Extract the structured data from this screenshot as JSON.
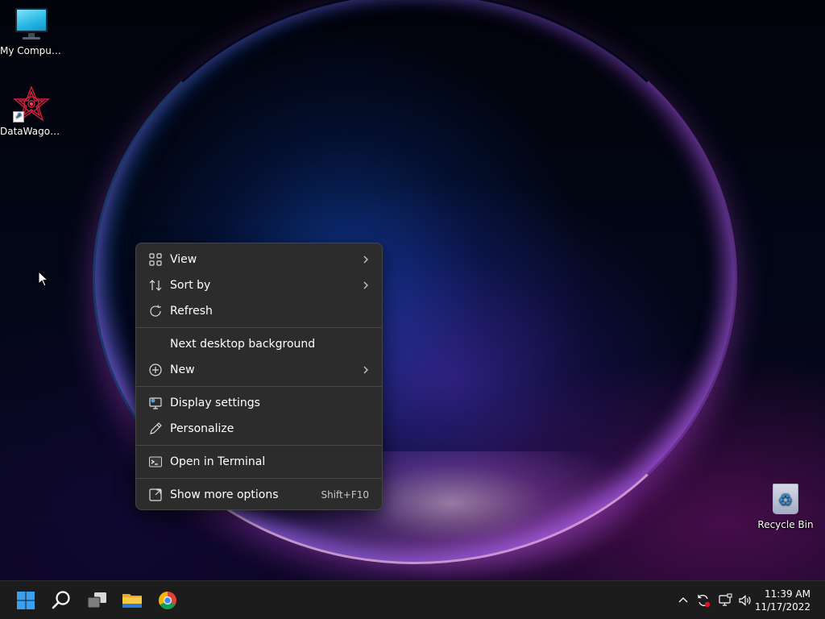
{
  "desktop": {
    "icons": [
      {
        "label": "My Computer",
        "icon": "monitor-icon"
      },
      {
        "label": "DataWagon...",
        "icon": "datawagon-logo-icon"
      },
      {
        "label": "Recycle Bin",
        "icon": "recycle-bin-icon"
      }
    ]
  },
  "context_menu": {
    "items": [
      {
        "label": "View",
        "icon": "grid-view-icon",
        "submenu": true
      },
      {
        "label": "Sort by",
        "icon": "sort-arrows-icon",
        "submenu": true
      },
      {
        "label": "Refresh",
        "icon": "refresh-icon",
        "submenu": false
      },
      {
        "label": "Next desktop background",
        "icon": "",
        "submenu": false
      },
      {
        "label": "New",
        "icon": "plus-circle-icon",
        "submenu": true
      },
      {
        "label": "Display settings",
        "icon": "display-settings-icon",
        "submenu": false
      },
      {
        "label": "Personalize",
        "icon": "pen-icon",
        "submenu": false
      },
      {
        "label": "Open in Terminal",
        "icon": "terminal-icon",
        "submenu": false
      },
      {
        "label": "Show more options",
        "icon": "expand-icon",
        "submenu": false,
        "shortcut": "Shift+F10"
      }
    ]
  },
  "taskbar": {
    "apps": [
      {
        "name": "Start",
        "icon": "windows-start-icon"
      },
      {
        "name": "Search",
        "icon": "search-icon"
      },
      {
        "name": "Task View",
        "icon": "task-view-icon"
      },
      {
        "name": "File Explorer",
        "icon": "folder-icon"
      },
      {
        "name": "Google Chrome",
        "icon": "chrome-icon"
      }
    ],
    "tray_icons": [
      "chevron-up-icon",
      "sync-icon",
      "network-icon",
      "volume-icon"
    ],
    "clock": {
      "time": "11:39 AM",
      "date": "11/17/2022"
    }
  },
  "colors": {
    "menu_bg": "#2c2c2c",
    "taskbar_bg": "#1c1c1c",
    "start_blue": "#3aa0f0"
  }
}
